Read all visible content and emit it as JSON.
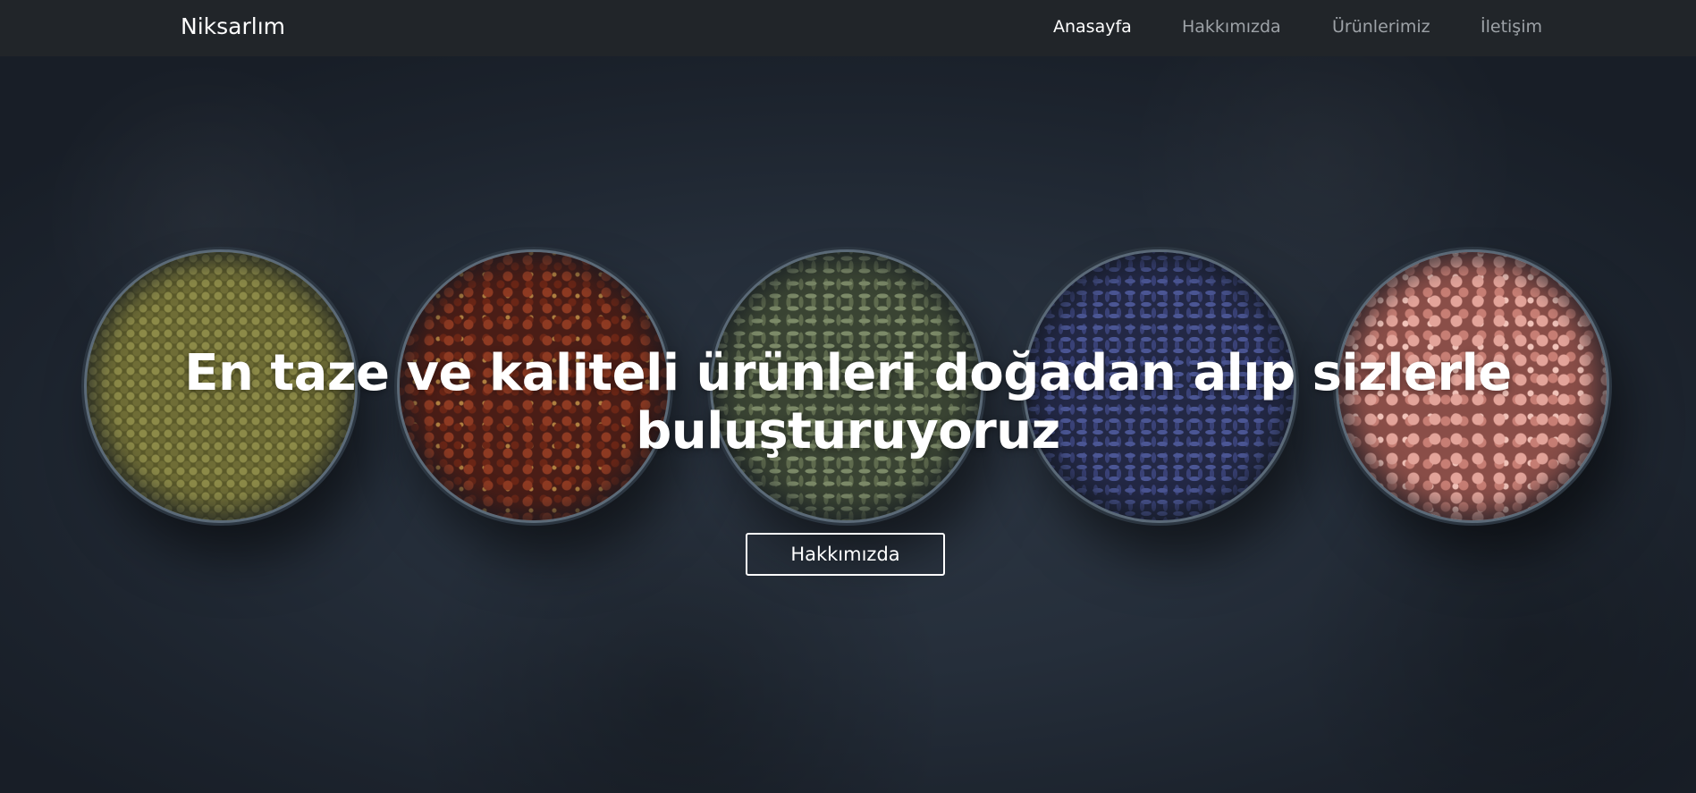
{
  "navbar": {
    "brand": "Niksarlım",
    "links": [
      {
        "label": "Anasayfa",
        "active": true
      },
      {
        "label": "Hakkımızda",
        "active": false
      },
      {
        "label": "Ürünlerimiz",
        "active": false
      },
      {
        "label": "İletişim",
        "active": false
      }
    ]
  },
  "hero": {
    "title": "En taze ve kaliteli ürünleri doğadan alıp sizlerle buluşturuyoruz",
    "button_label": "Hakkımızda"
  },
  "colors": {
    "navbar_bg": "#212529",
    "nav_active": "#ffffff",
    "nav_inactive": "#9da2a7",
    "hero_bg": "#252e3a"
  }
}
